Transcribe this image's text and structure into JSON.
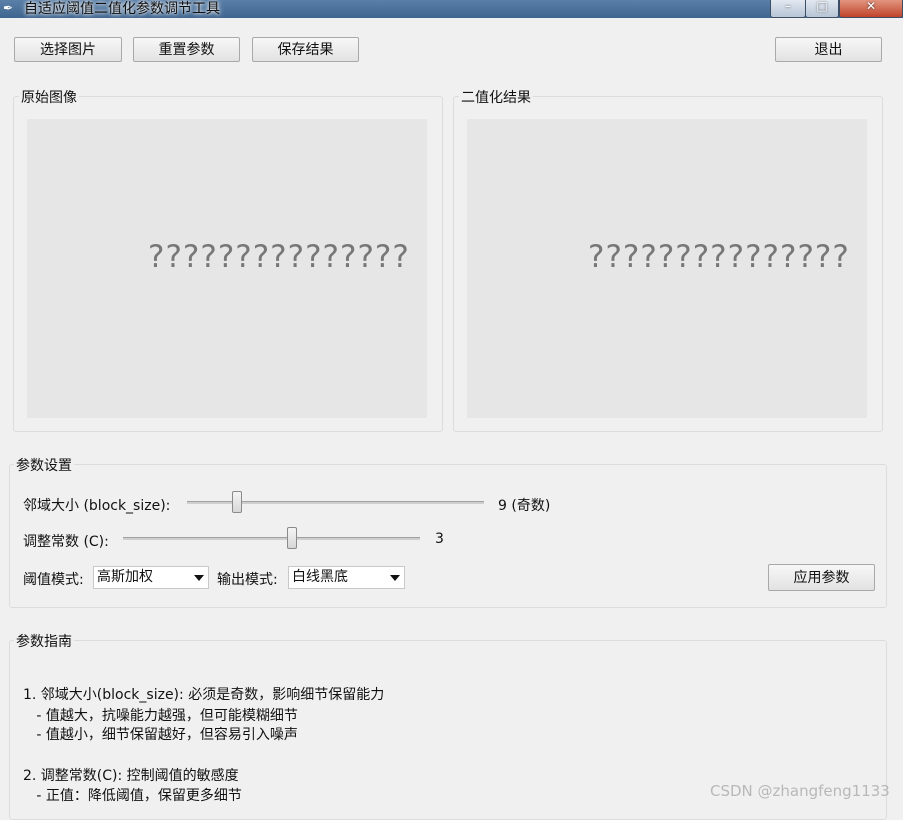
{
  "window": {
    "title": "自适应阈值二值化参数调节工具",
    "icon": "feather-icon",
    "controls": {
      "minimize": "–",
      "maximize": "□",
      "close": "✕"
    }
  },
  "toolbar": {
    "select_image": "选择图片",
    "reset_params": "重置参数",
    "save_result": "保存结果",
    "exit": "退出"
  },
  "panels": {
    "original": {
      "label": "原始图像",
      "placeholder": "???????????????"
    },
    "binary": {
      "label": "二值化结果",
      "placeholder": "???????????????"
    }
  },
  "params": {
    "label": "参数设置",
    "block_size": {
      "label": "邻域大小 (block_size):",
      "value_text": "9 (奇数)",
      "level": 0.17
    },
    "constant_c": {
      "label": "调整常数 (C):",
      "value_text": "3",
      "level": 0.57
    },
    "threshold_mode": {
      "label": "阈值模式:",
      "selected": "高斯加权"
    },
    "output_mode": {
      "label": "输出模式:",
      "selected": "白线黑底"
    },
    "apply": "应用参数"
  },
  "guide": {
    "label": "参数指南",
    "lines": [
      "1. 邻域大小(block_size): 必须是奇数，影响细节保留能力",
      "   - 值越大，抗噪能力越强，但可能模糊细节",
      "   - 值越小，细节保留越好，但容易引入噪声",
      "",
      "2. 调整常数(C): 控制阈值的敏感度",
      "   - 正值：降低阈值，保留更多细节"
    ]
  },
  "watermark": "CSDN @zhangfeng1133"
}
